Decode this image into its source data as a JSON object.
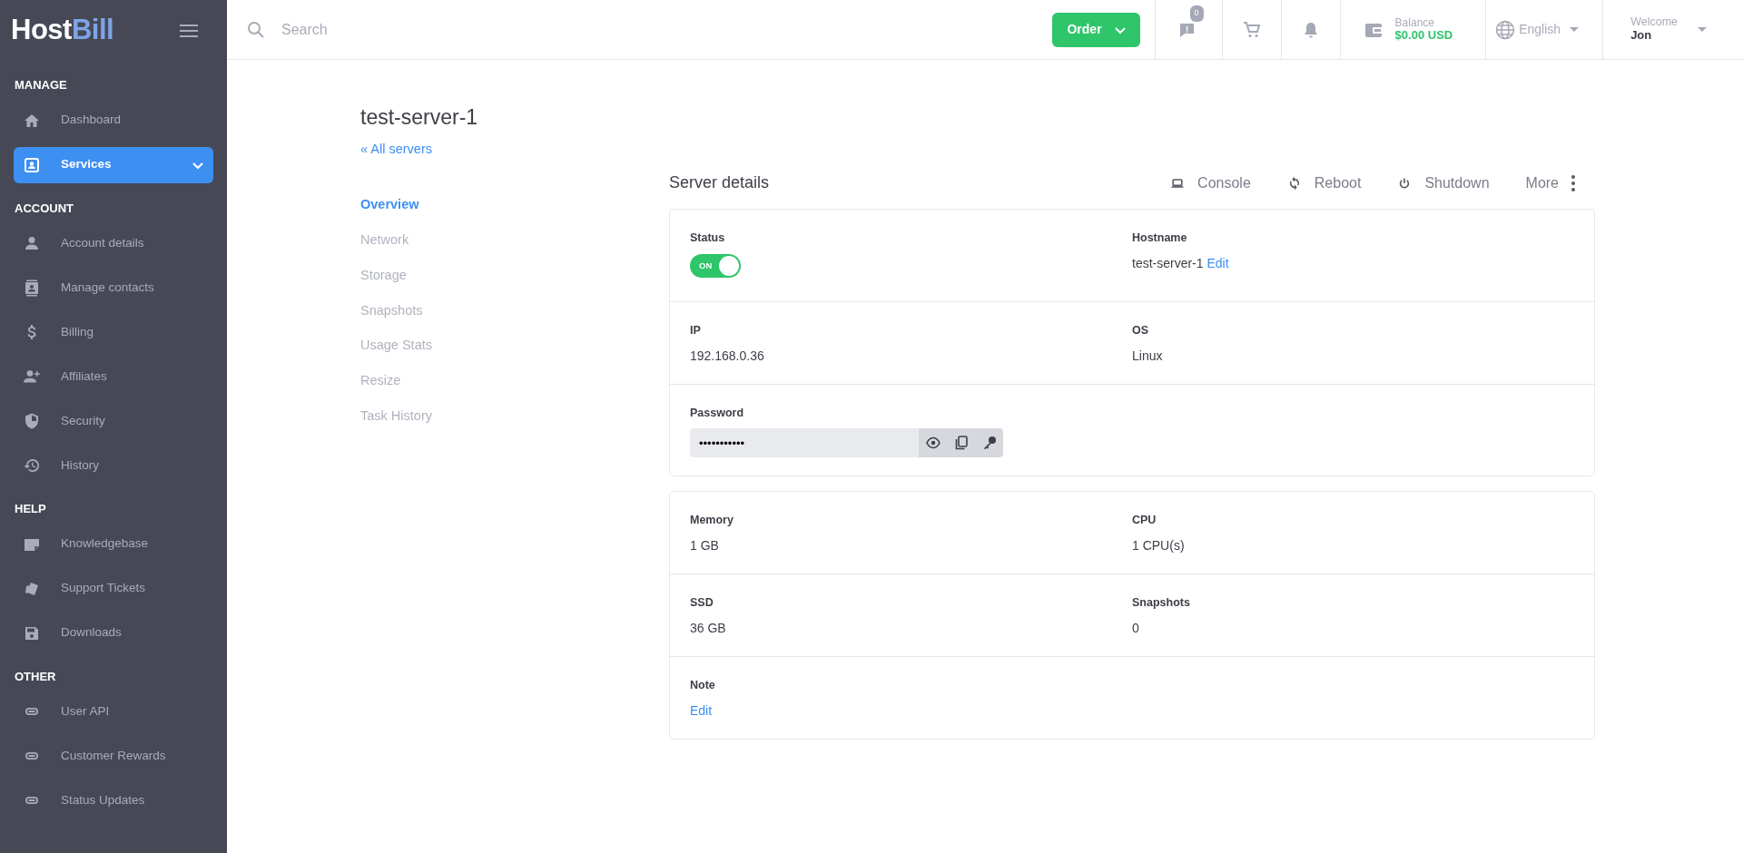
{
  "sidebar": {
    "logo": {
      "part_1": "Host",
      "part_2": "Bill"
    },
    "sections": [
      {
        "heading": "MANAGE",
        "items": [
          {
            "label": "Dashboard",
            "selected": false,
            "expandable": false
          },
          {
            "label": "Services",
            "selected": true,
            "expandable": true
          }
        ]
      },
      {
        "heading": "ACCOUNT",
        "items": [
          {
            "label": "Account details",
            "selected": false,
            "expandable": false
          },
          {
            "label": "Manage contacts",
            "selected": false,
            "expandable": false
          },
          {
            "label": "Billing",
            "selected": false,
            "expandable": false
          },
          {
            "label": "Affiliates",
            "selected": false,
            "expandable": false
          },
          {
            "label": "Security",
            "selected": false,
            "expandable": false
          },
          {
            "label": "History",
            "selected": false,
            "expandable": false
          }
        ]
      },
      {
        "heading": "HELP",
        "items": [
          {
            "label": "Knowledgebase",
            "selected": false,
            "expandable": false
          },
          {
            "label": "Support Tickets",
            "selected": false,
            "expandable": false
          },
          {
            "label": "Downloads",
            "selected": false,
            "expandable": false
          }
        ]
      },
      {
        "heading": "OTHER",
        "items": [
          {
            "label": "User API",
            "selected": false,
            "expandable": false
          },
          {
            "label": "Customer Rewards",
            "selected": false,
            "expandable": false
          },
          {
            "label": "Status Updates",
            "selected": false,
            "expandable": false
          }
        ]
      }
    ]
  },
  "topbar": {
    "search": {
      "placeholder": "Search"
    },
    "order_button": "Order",
    "messages_badge": "0",
    "balance": {
      "label": "Balance",
      "value": "$0.00 USD"
    },
    "language": "English",
    "welcome": {
      "label": "Welcome",
      "user": "Jon"
    }
  },
  "main": {
    "title": "test-server-1",
    "back_link": "« All servers",
    "subnav": [
      {
        "label": "Overview",
        "selected": true
      },
      {
        "label": "Network",
        "selected": false
      },
      {
        "label": "Storage",
        "selected": false
      },
      {
        "label": "Snapshots",
        "selected": false
      },
      {
        "label": "Usage Stats",
        "selected": false
      },
      {
        "label": "Resize",
        "selected": false
      },
      {
        "label": "Task History",
        "selected": false
      }
    ],
    "details": {
      "title": "Server details",
      "actions": [
        {
          "label": "Console"
        },
        {
          "label": "Reboot"
        },
        {
          "label": "Shutdown"
        }
      ],
      "more": "More",
      "cards": [
        [
          [
            {
              "label": "Status",
              "kind": "toggle",
              "on": true,
              "toggle_text": "ON"
            },
            {
              "label": "Hostname",
              "kind": "text",
              "value": "test-server-1",
              "link": "Edit"
            }
          ],
          [
            {
              "label": "IP",
              "kind": "text",
              "value": "192.168.0.36"
            },
            {
              "label": "OS",
              "kind": "text",
              "value": "Linux"
            }
          ],
          [
            {
              "label": "Password",
              "kind": "password",
              "value": "•••••••••••"
            }
          ]
        ],
        [
          [
            {
              "label": "Memory",
              "kind": "text",
              "value": "1 GB"
            },
            {
              "label": "CPU",
              "kind": "text",
              "value": "1 CPU(s)"
            }
          ],
          [
            {
              "label": "SSD",
              "kind": "text",
              "value": "36 GB"
            },
            {
              "label": "Snapshots",
              "kind": "text",
              "value": "0"
            }
          ],
          [
            {
              "label": "Note",
              "kind": "link",
              "value": "Edit"
            }
          ]
        ]
      ]
    }
  }
}
